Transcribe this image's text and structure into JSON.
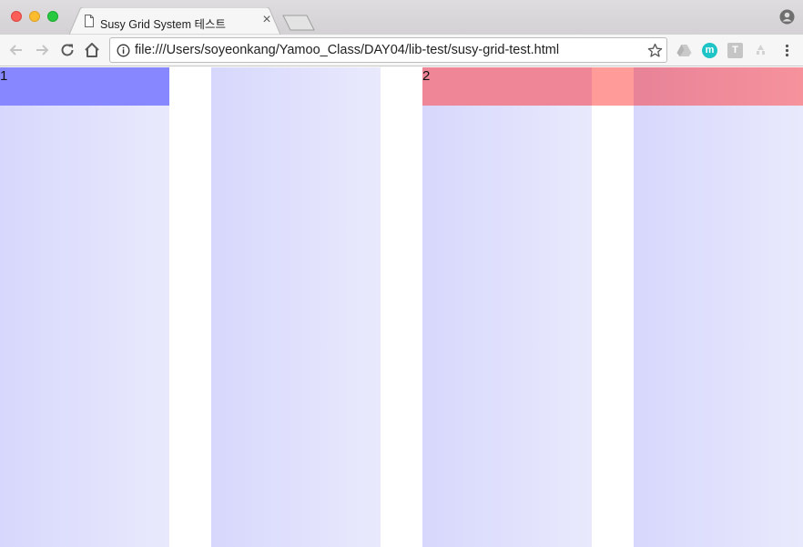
{
  "browser": {
    "tab": {
      "title": "Susy Grid System 테스트",
      "close_glyph": "×",
      "icon": "document-icon"
    },
    "toolbar": {
      "back_icon": "back-arrow-icon",
      "forward_icon": "forward-arrow-icon",
      "reload_icon": "reload-icon",
      "home_icon": "home-icon"
    },
    "omnibox": {
      "url": "file:///Users/soyeonkang/Yamoo_Class/DAY04/lib-test/susy-grid-test.html",
      "info_icon": "info-icon",
      "bookmark_icon": "star-icon"
    },
    "extensions": [
      {
        "name": "drive-icon",
        "label": ""
      },
      {
        "name": "m-extension-icon",
        "label": "m"
      },
      {
        "name": "t-extension-icon",
        "label": "T"
      },
      {
        "name": "puzzle-extension-icon",
        "label": ""
      }
    ],
    "menu_icon": "kebab-menu-icon",
    "profile_icon": "profile-icon"
  },
  "page": {
    "items": [
      {
        "label": "1",
        "color": "#8787ff"
      },
      {
        "label": "2",
        "color": "#f39298"
      }
    ],
    "column_gradient": [
      "#d7d7fd",
      "#e9e9fd"
    ],
    "gutter_color": "#ffffff"
  }
}
